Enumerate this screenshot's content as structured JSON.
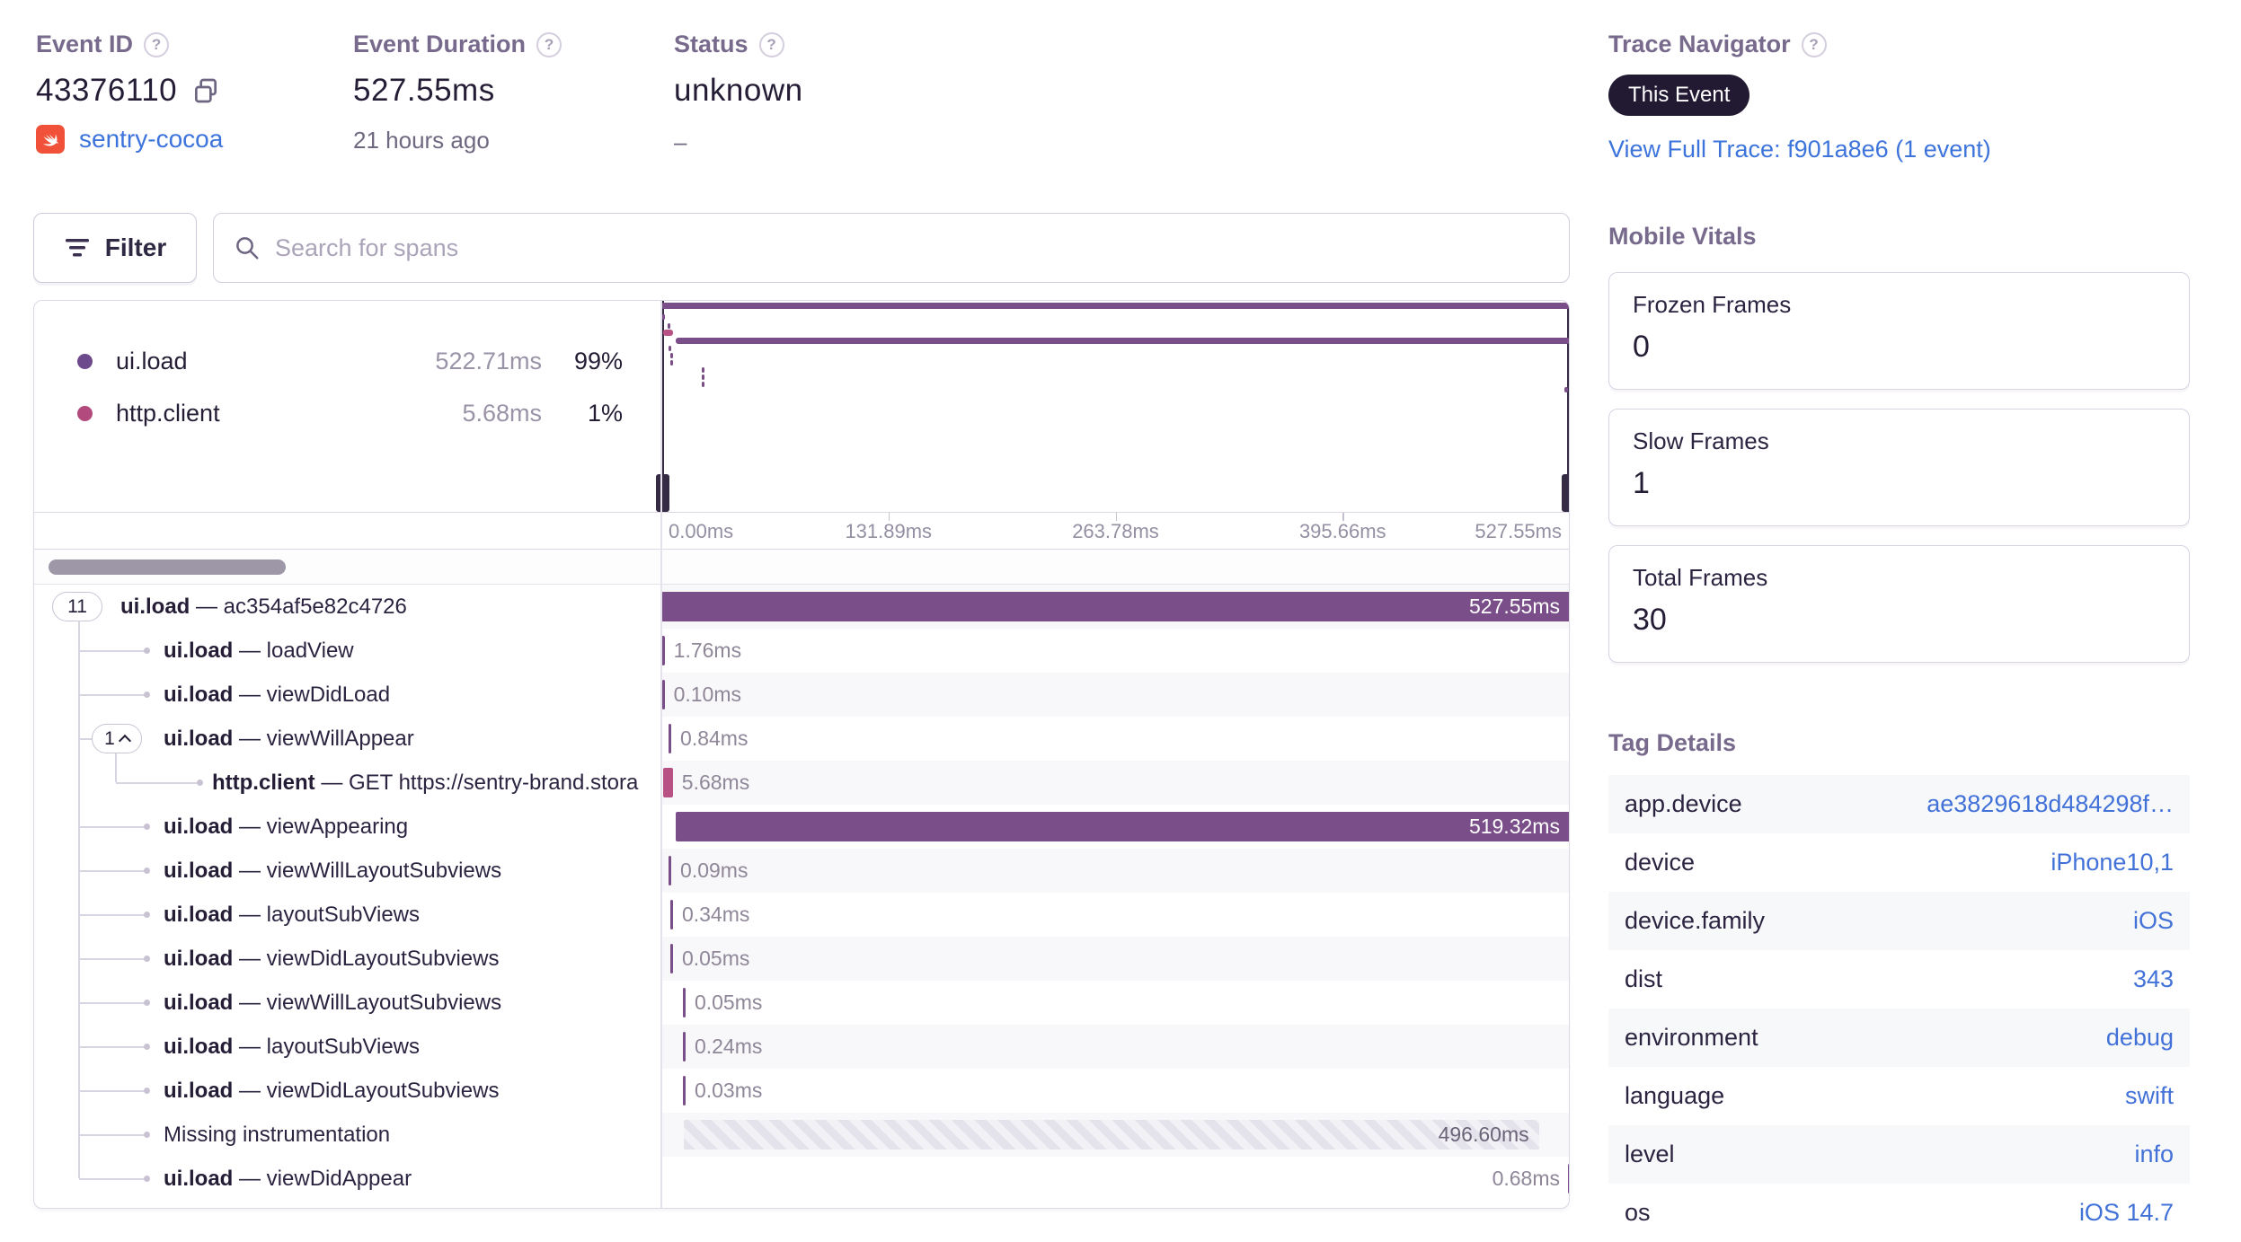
{
  "header": {
    "event_id": {
      "label": "Event ID",
      "value": "43376110",
      "project": "sentry-cocoa"
    },
    "event_duration": {
      "label": "Event Duration",
      "value": "527.55ms",
      "ago": "21 hours ago"
    },
    "status": {
      "label": "Status",
      "value": "unknown",
      "sub": "–"
    }
  },
  "trace_navigator": {
    "label": "Trace Navigator",
    "badge": "This Event",
    "link": "View Full Trace: f901a8e6 (1 event)"
  },
  "toolbar": {
    "filter_label": "Filter",
    "search_placeholder": "Search for spans"
  },
  "legend": {
    "items": [
      {
        "name": "ui.load",
        "color": "#6d4a8c",
        "duration": "522.71ms",
        "pct": "99%"
      },
      {
        "name": "http.client",
        "color": "#b24a7d",
        "duration": "5.68ms",
        "pct": "1%"
      }
    ]
  },
  "timeline": {
    "total_ms": 527.55,
    "axis_ticks": [
      "0.00ms",
      "131.89ms",
      "263.78ms",
      "395.66ms",
      "527.55ms"
    ],
    "minimap_marks": [
      {
        "start_ms": 0,
        "dur_ms": 527.55,
        "y": 2,
        "h": 7,
        "color": "#7a4e89"
      },
      {
        "start_ms": 0.3,
        "dur_ms": 1.2,
        "y": 15,
        "h": 6,
        "color": "#7a4e89"
      },
      {
        "start_ms": 3.6,
        "dur_ms": 1.2,
        "y": 25,
        "h": 6,
        "color": "#7a4e89"
      },
      {
        "start_ms": 1.0,
        "dur_ms": 5.68,
        "y": 32,
        "h": 7,
        "color": "#b85284"
      },
      {
        "start_ms": 8.2,
        "dur_ms": 519.32,
        "y": 41,
        "h": 7,
        "color": "#7a4e89"
      },
      {
        "start_ms": 4.2,
        "dur_ms": 1.0,
        "y": 50,
        "h": 6,
        "color": "#7a4e89"
      },
      {
        "start_ms": 5.2,
        "dur_ms": 1.0,
        "y": 58,
        "h": 6,
        "color": "#7a4e89"
      },
      {
        "start_ms": 5.2,
        "dur_ms": 1.0,
        "y": 66,
        "h": 6,
        "color": "#7a4e89"
      },
      {
        "start_ms": 23.5,
        "dur_ms": 1.0,
        "y": 74,
        "h": 6,
        "color": "#7a4e89"
      },
      {
        "start_ms": 23.5,
        "dur_ms": 1.0,
        "y": 82,
        "h": 6,
        "color": "#7a4e89"
      },
      {
        "start_ms": 23.5,
        "dur_ms": 1.0,
        "y": 90,
        "h": 6,
        "color": "#7a4e89"
      },
      {
        "start_ms": 524.5,
        "dur_ms": 2.0,
        "y": 96,
        "h": 6,
        "color": "#7a4e89"
      }
    ]
  },
  "spans": [
    {
      "op": "ui.load",
      "desc": "ac354af5e82c4726",
      "duration_label": "527.55ms",
      "duration_ms": 527.55,
      "start_ms": 0,
      "level": 0,
      "pill": "11",
      "pill_caret": false,
      "color": "#7a4e89",
      "label_pos": "inside"
    },
    {
      "op": "ui.load",
      "desc": "loadView",
      "duration_label": "1.76ms",
      "duration_ms": 1.76,
      "start_ms": 0.15,
      "level": 1,
      "color": "#7a4e89",
      "label_pos": "after"
    },
    {
      "op": "ui.load",
      "desc": "viewDidLoad",
      "duration_label": "0.10ms",
      "duration_ms": 0.1,
      "start_ms": 0.3,
      "level": 1,
      "color": "#7a4e89",
      "label_pos": "after"
    },
    {
      "op": "ui.load",
      "desc": "viewWillAppear",
      "duration_label": "0.84ms",
      "duration_ms": 0.84,
      "start_ms": 4.2,
      "level": 1,
      "pill": "1",
      "pill_caret": true,
      "color": "#7a4e89",
      "label_pos": "after"
    },
    {
      "op": "http.client",
      "desc": "GET https://sentry-brand.stora",
      "duration_label": "5.68ms",
      "duration_ms": 5.68,
      "start_ms": 1.0,
      "level": 2,
      "color": "#b85284",
      "label_pos": "after"
    },
    {
      "op": "ui.load",
      "desc": "viewAppearing",
      "duration_label": "519.32ms",
      "duration_ms": 519.32,
      "start_ms": 8.2,
      "level": 1,
      "color": "#7a4e89",
      "label_pos": "inside"
    },
    {
      "op": "ui.load",
      "desc": "viewWillLayoutSubviews",
      "duration_label": "0.09ms",
      "duration_ms": 0.09,
      "start_ms": 4.2,
      "level": 1,
      "color": "#7a4e89",
      "label_pos": "after"
    },
    {
      "op": "ui.load",
      "desc": "layoutSubViews",
      "duration_label": "0.34ms",
      "duration_ms": 0.34,
      "start_ms": 5.2,
      "level": 1,
      "color": "#7a4e89",
      "label_pos": "after"
    },
    {
      "op": "ui.load",
      "desc": "viewDidLayoutSubviews",
      "duration_label": "0.05ms",
      "duration_ms": 0.05,
      "start_ms": 5.2,
      "level": 1,
      "color": "#7a4e89",
      "label_pos": "after"
    },
    {
      "op": "ui.load",
      "desc": "viewWillLayoutSubviews",
      "duration_label": "0.05ms",
      "duration_ms": 0.05,
      "start_ms": 12.5,
      "level": 1,
      "color": "#7a4e89",
      "label_pos": "after"
    },
    {
      "op": "ui.load",
      "desc": "layoutSubViews",
      "duration_label": "0.24ms",
      "duration_ms": 0.24,
      "start_ms": 12.5,
      "level": 1,
      "color": "#7a4e89",
      "label_pos": "after"
    },
    {
      "op": "ui.load",
      "desc": "viewDidLayoutSubviews",
      "duration_label": "0.03ms",
      "duration_ms": 0.03,
      "start_ms": 12.5,
      "level": 1,
      "color": "#7a4e89",
      "label_pos": "after"
    },
    {
      "op": "",
      "desc": "Missing instrumentation",
      "duration_label": "496.60ms",
      "duration_ms": 496.6,
      "start_ms": 13.0,
      "level": 1,
      "kind": "missing",
      "label_pos": "inside-dark"
    },
    {
      "op": "ui.load",
      "desc": "viewDidAppear",
      "duration_label": "0.68ms",
      "duration_ms": 0.68,
      "start_ms": 526.5,
      "level": 1,
      "color": "#7a4e89",
      "label_pos": "before"
    }
  ],
  "mobile_vitals": {
    "label": "Mobile Vitals",
    "cards": [
      {
        "label": "Frozen Frames",
        "value": "0"
      },
      {
        "label": "Slow Frames",
        "value": "1"
      },
      {
        "label": "Total Frames",
        "value": "30"
      }
    ]
  },
  "tag_details": {
    "label": "Tag Details",
    "rows": [
      {
        "key": "app.device",
        "value": "ae3829618d484298f…"
      },
      {
        "key": "device",
        "value": "iPhone10,1"
      },
      {
        "key": "device.family",
        "value": "iOS"
      },
      {
        "key": "dist",
        "value": "343"
      },
      {
        "key": "environment",
        "value": "debug"
      },
      {
        "key": "language",
        "value": "swift"
      },
      {
        "key": "level",
        "value": "info"
      },
      {
        "key": "os",
        "value": "iOS 14.7"
      }
    ]
  },
  "colors": {
    "accent_purple": "#7a4e89",
    "accent_pink": "#b85284",
    "link_blue": "#3d74db",
    "swift_orange": "#f05138"
  }
}
